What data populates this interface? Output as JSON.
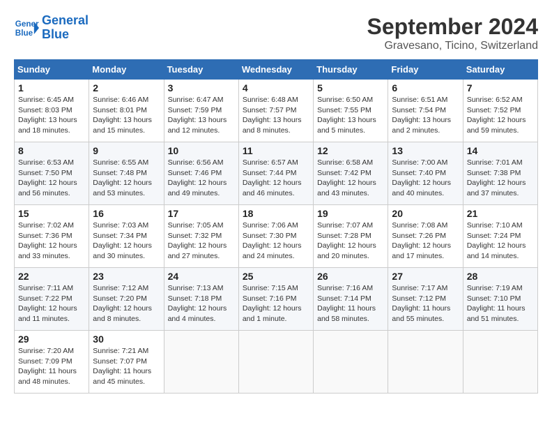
{
  "header": {
    "logo_line1": "General",
    "logo_line2": "Blue",
    "month": "September 2024",
    "location": "Gravesano, Ticino, Switzerland"
  },
  "weekdays": [
    "Sunday",
    "Monday",
    "Tuesday",
    "Wednesday",
    "Thursday",
    "Friday",
    "Saturday"
  ],
  "weeks": [
    [
      {
        "day": "1",
        "sunrise": "6:45 AM",
        "sunset": "8:03 PM",
        "daylight": "13 hours and 18 minutes."
      },
      {
        "day": "2",
        "sunrise": "6:46 AM",
        "sunset": "8:01 PM",
        "daylight": "13 hours and 15 minutes."
      },
      {
        "day": "3",
        "sunrise": "6:47 AM",
        "sunset": "7:59 PM",
        "daylight": "13 hours and 12 minutes."
      },
      {
        "day": "4",
        "sunrise": "6:48 AM",
        "sunset": "7:57 PM",
        "daylight": "13 hours and 8 minutes."
      },
      {
        "day": "5",
        "sunrise": "6:50 AM",
        "sunset": "7:55 PM",
        "daylight": "13 hours and 5 minutes."
      },
      {
        "day": "6",
        "sunrise": "6:51 AM",
        "sunset": "7:54 PM",
        "daylight": "13 hours and 2 minutes."
      },
      {
        "day": "7",
        "sunrise": "6:52 AM",
        "sunset": "7:52 PM",
        "daylight": "12 hours and 59 minutes."
      }
    ],
    [
      {
        "day": "8",
        "sunrise": "6:53 AM",
        "sunset": "7:50 PM",
        "daylight": "12 hours and 56 minutes."
      },
      {
        "day": "9",
        "sunrise": "6:55 AM",
        "sunset": "7:48 PM",
        "daylight": "12 hours and 53 minutes."
      },
      {
        "day": "10",
        "sunrise": "6:56 AM",
        "sunset": "7:46 PM",
        "daylight": "12 hours and 49 minutes."
      },
      {
        "day": "11",
        "sunrise": "6:57 AM",
        "sunset": "7:44 PM",
        "daylight": "12 hours and 46 minutes."
      },
      {
        "day": "12",
        "sunrise": "6:58 AM",
        "sunset": "7:42 PM",
        "daylight": "12 hours and 43 minutes."
      },
      {
        "day": "13",
        "sunrise": "7:00 AM",
        "sunset": "7:40 PM",
        "daylight": "12 hours and 40 minutes."
      },
      {
        "day": "14",
        "sunrise": "7:01 AM",
        "sunset": "7:38 PM",
        "daylight": "12 hours and 37 minutes."
      }
    ],
    [
      {
        "day": "15",
        "sunrise": "7:02 AM",
        "sunset": "7:36 PM",
        "daylight": "12 hours and 33 minutes."
      },
      {
        "day": "16",
        "sunrise": "7:03 AM",
        "sunset": "7:34 PM",
        "daylight": "12 hours and 30 minutes."
      },
      {
        "day": "17",
        "sunrise": "7:05 AM",
        "sunset": "7:32 PM",
        "daylight": "12 hours and 27 minutes."
      },
      {
        "day": "18",
        "sunrise": "7:06 AM",
        "sunset": "7:30 PM",
        "daylight": "12 hours and 24 minutes."
      },
      {
        "day": "19",
        "sunrise": "7:07 AM",
        "sunset": "7:28 PM",
        "daylight": "12 hours and 20 minutes."
      },
      {
        "day": "20",
        "sunrise": "7:08 AM",
        "sunset": "7:26 PM",
        "daylight": "12 hours and 17 minutes."
      },
      {
        "day": "21",
        "sunrise": "7:10 AM",
        "sunset": "7:24 PM",
        "daylight": "12 hours and 14 minutes."
      }
    ],
    [
      {
        "day": "22",
        "sunrise": "7:11 AM",
        "sunset": "7:22 PM",
        "daylight": "12 hours and 11 minutes."
      },
      {
        "day": "23",
        "sunrise": "7:12 AM",
        "sunset": "7:20 PM",
        "daylight": "12 hours and 8 minutes."
      },
      {
        "day": "24",
        "sunrise": "7:13 AM",
        "sunset": "7:18 PM",
        "daylight": "12 hours and 4 minutes."
      },
      {
        "day": "25",
        "sunrise": "7:15 AM",
        "sunset": "7:16 PM",
        "daylight": "12 hours and 1 minute."
      },
      {
        "day": "26",
        "sunrise": "7:16 AM",
        "sunset": "7:14 PM",
        "daylight": "11 hours and 58 minutes."
      },
      {
        "day": "27",
        "sunrise": "7:17 AM",
        "sunset": "7:12 PM",
        "daylight": "11 hours and 55 minutes."
      },
      {
        "day": "28",
        "sunrise": "7:19 AM",
        "sunset": "7:10 PM",
        "daylight": "11 hours and 51 minutes."
      }
    ],
    [
      {
        "day": "29",
        "sunrise": "7:20 AM",
        "sunset": "7:09 PM",
        "daylight": "11 hours and 48 minutes."
      },
      {
        "day": "30",
        "sunrise": "7:21 AM",
        "sunset": "7:07 PM",
        "daylight": "11 hours and 45 minutes."
      },
      null,
      null,
      null,
      null,
      null
    ]
  ]
}
